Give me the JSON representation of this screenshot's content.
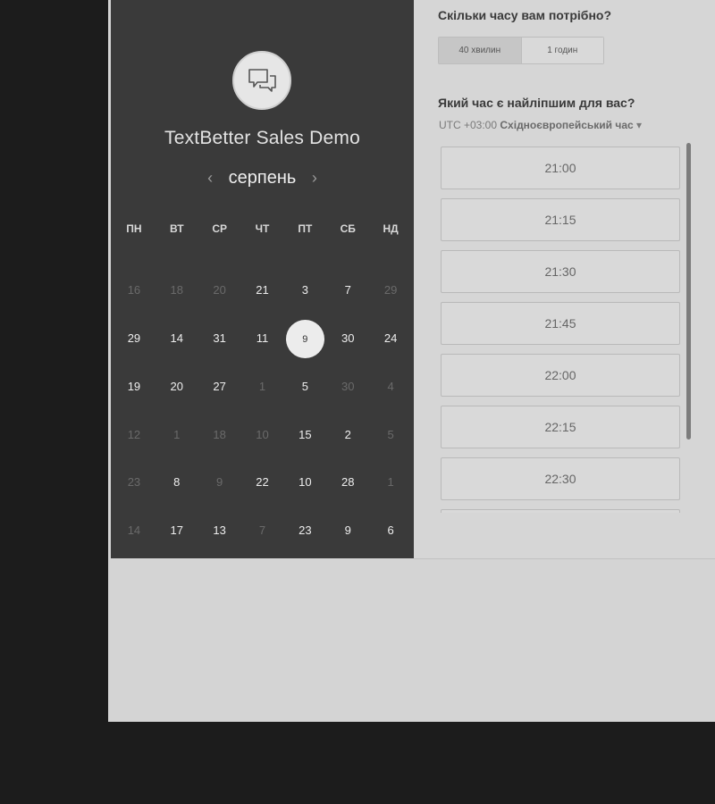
{
  "calendar": {
    "title": "TextBetter Sales Demo",
    "month": "серпень",
    "prev_arrow": "‹",
    "next_arrow": "›",
    "weekdays": [
      "ПН",
      "ВТ",
      "СР",
      "ЧТ",
      "ПТ",
      "СБ",
      "НД"
    ],
    "weeks": [
      [
        {
          "d": "16",
          "on": false
        },
        {
          "d": "18",
          "on": false
        },
        {
          "d": "20",
          "on": false
        },
        {
          "d": "21",
          "on": true
        },
        {
          "d": "3",
          "on": true
        },
        {
          "d": "7",
          "on": true
        },
        {
          "d": "29",
          "on": false
        }
      ],
      [
        {
          "d": "29",
          "on": true
        },
        {
          "d": "14",
          "on": true
        },
        {
          "d": "31",
          "on": true
        },
        {
          "d": "11",
          "on": true
        },
        {
          "d": "9",
          "on": true,
          "selected": true
        },
        {
          "d": "30",
          "on": true
        },
        {
          "d": "24",
          "on": true
        }
      ],
      [
        {
          "d": "19",
          "on": true
        },
        {
          "d": "20",
          "on": true
        },
        {
          "d": "27",
          "on": true
        },
        {
          "d": "1",
          "on": false
        },
        {
          "d": "5",
          "on": true
        },
        {
          "d": "30",
          "on": false
        },
        {
          "d": "4",
          "on": false
        }
      ],
      [
        {
          "d": "12",
          "on": false
        },
        {
          "d": "1",
          "on": false
        },
        {
          "d": "18",
          "on": false
        },
        {
          "d": "10",
          "on": false
        },
        {
          "d": "15",
          "on": true
        },
        {
          "d": "2",
          "on": true
        },
        {
          "d": "5",
          "on": false
        }
      ],
      [
        {
          "d": "23",
          "on": false
        },
        {
          "d": "8",
          "on": true
        },
        {
          "d": "9",
          "on": false
        },
        {
          "d": "22",
          "on": true
        },
        {
          "d": "10",
          "on": true
        },
        {
          "d": "28",
          "on": true
        },
        {
          "d": "1",
          "on": false
        }
      ],
      [
        {
          "d": "14",
          "on": false
        },
        {
          "d": "17",
          "on": true
        },
        {
          "d": "13",
          "on": true
        },
        {
          "d": "7",
          "on": false
        },
        {
          "d": "23",
          "on": true
        },
        {
          "d": "9",
          "on": true
        },
        {
          "d": "6",
          "on": true
        }
      ]
    ]
  },
  "booking": {
    "duration_question": "Скільки часу вам потрібно?",
    "durations": [
      "40 хвилин",
      "1 годин"
    ],
    "time_question": "Який час є найліпшим для вас?",
    "tz_offset": "UTC +03:00",
    "tz_name": "Східноєвропейський час",
    "tz_caret": "▾",
    "slots": [
      "21:00",
      "21:15",
      "21:30",
      "21:45",
      "22:00",
      "22:15",
      "22:30",
      ""
    ]
  }
}
